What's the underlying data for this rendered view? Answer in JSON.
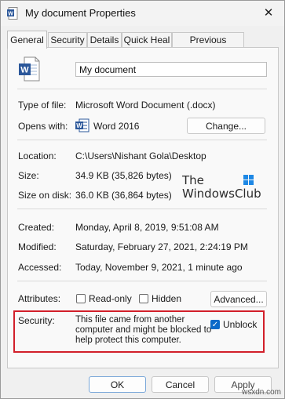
{
  "window": {
    "title": "My document Properties",
    "close_glyph": "✕"
  },
  "tabs": [
    {
      "label": "General",
      "active": true
    },
    {
      "label": "Security",
      "active": false
    },
    {
      "label": "Details",
      "active": false
    },
    {
      "label": "Quick Heal",
      "active": false
    },
    {
      "label": "Previous Versions",
      "active": false
    }
  ],
  "general": {
    "file_name": "My document",
    "type_label": "Type of file:",
    "type_value": "Microsoft Word Document (.docx)",
    "opens_label": "Opens with:",
    "opens_value": "Word 2016",
    "change_button": "Change...",
    "location_label": "Location:",
    "location_value": "C:\\Users\\Nishant Gola\\Desktop",
    "size_label": "Size:",
    "size_value": "34.9 KB (35,826 bytes)",
    "size_disk_label": "Size on disk:",
    "size_disk_value": "36.0 KB (36,864 bytes)",
    "created_label": "Created:",
    "created_value": "Monday, April 8, 2019, 9:51:08 AM",
    "modified_label": "Modified:",
    "modified_value": "Saturday, February 27, 2021, 2:24:19 PM",
    "accessed_label": "Accessed:",
    "accessed_value": "Today, November 9, 2021, 1 minute ago",
    "attributes_label": "Attributes:",
    "readonly_label": "Read-only",
    "readonly_checked": false,
    "hidden_label": "Hidden",
    "hidden_checked": false,
    "advanced_button": "Advanced...",
    "security_label": "Security:",
    "security_line1": "This file came from another",
    "security_line2": "computer and might be blocked to",
    "security_line3": "help protect this computer.",
    "unblock_label": "Unblock",
    "unblock_checked": true
  },
  "watermark": {
    "line1": "The",
    "line2": "WindowsClub"
  },
  "footer": {
    "ok": "OK",
    "cancel": "Cancel",
    "apply": "Apply",
    "brand": "wsxdn.com"
  },
  "colors": {
    "accent": "#0b6ac9",
    "highlight_border": "#d21f2a",
    "word_blue": "#2b579a"
  },
  "icons": {
    "title": "word-document-icon",
    "file": "word-document-icon",
    "opens_with": "word-app-icon",
    "watermark": "windowsclub-logo"
  }
}
